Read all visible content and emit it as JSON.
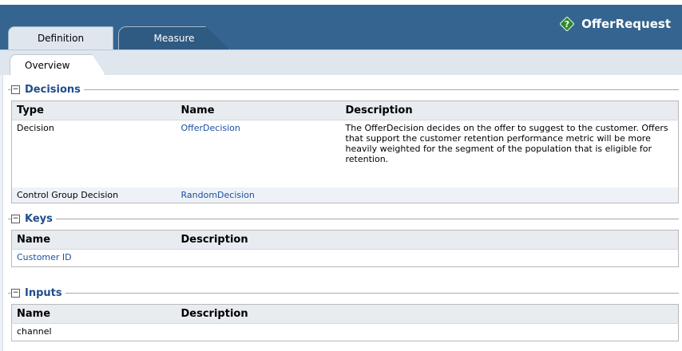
{
  "header": {
    "app_title": "OfferRequest",
    "tabs": [
      {
        "label": "Definition",
        "active": true
      },
      {
        "label": "Measure",
        "active": false
      }
    ],
    "subtab": "Overview"
  },
  "sections": {
    "decisions": {
      "title": "Decisions",
      "columns": [
        "Type",
        "Name",
        "Description"
      ],
      "rows": [
        {
          "type": "Decision",
          "name": "OfferDecision",
          "description": "The OfferDecision decides on the offer to suggest to the customer. Offers that support the customer retention performance metric will be more heavily weighted for the segment of the population that is eligible for retention."
        },
        {
          "type": "Control Group Decision",
          "name": "RandomDecision",
          "description": ""
        }
      ]
    },
    "keys": {
      "title": "Keys",
      "columns": [
        "Name",
        "Description"
      ],
      "rows": [
        {
          "name": "Customer ID",
          "description": ""
        }
      ]
    },
    "inputs": {
      "title": "Inputs",
      "columns": [
        "Name",
        "Description"
      ],
      "rows": [
        {
          "name": "channel",
          "description": ""
        }
      ]
    }
  },
  "icons": {
    "app": "green-diamond-help-icon",
    "collapse": "minus-box-icon"
  },
  "colors": {
    "header_blue": "#34648f",
    "section_title": "#1f4e8c",
    "link": "#1a4fa0",
    "table_header_bg": "#e8ecf1"
  }
}
